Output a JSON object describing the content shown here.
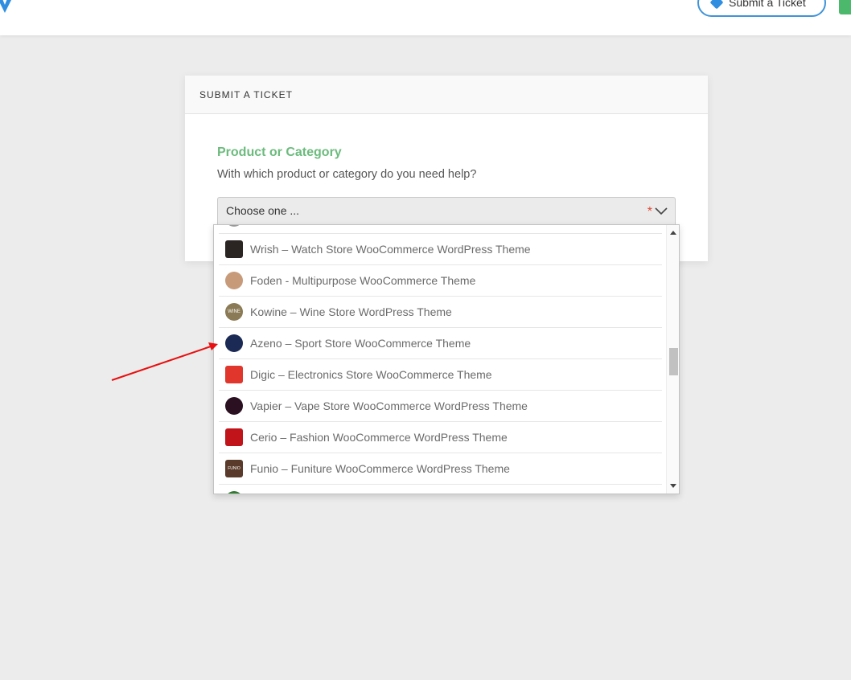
{
  "header": {
    "submit_ticket_label": "Submit a Ticket"
  },
  "card": {
    "title": "SUBMIT A TICKET",
    "field_title": "Product or Category",
    "field_desc": "With which product or category do you need help?"
  },
  "select": {
    "value": "Choose one ...",
    "required_mark": "*"
  },
  "options": [
    {
      "label": "",
      "icon": "partial-icon",
      "color": "#9a9a9a"
    },
    {
      "label": "Wrish – Watch Store WooCommerce WordPress Theme",
      "icon": "wrish-icon",
      "color": "#2a2422"
    },
    {
      "label": "Foden - Multipurpose WooCommerce Theme",
      "icon": "foden-icon",
      "color": "#c79a7a"
    },
    {
      "label": "Kowine – Wine Store WordPress Theme",
      "icon": "kowine-icon",
      "color": "#8a7a55"
    },
    {
      "label": "Azeno – Sport Store WooCommerce Theme",
      "icon": "azeno-icon",
      "color": "#1b2a55"
    },
    {
      "label": "Digic – Electronics Store WooCommerce Theme",
      "icon": "digic-icon",
      "color": "#e0362c"
    },
    {
      "label": "Vapier – Vape Store WooCommerce WordPress Theme",
      "icon": "vapier-icon",
      "color": "#2a1020"
    },
    {
      "label": "Cerio – Fashion WooCommerce WordPress Theme",
      "icon": "cerio-icon",
      "color": "#c0141a"
    },
    {
      "label": "Funio – Funiture WooCommerce WordPress Theme",
      "icon": "funio-icon",
      "color": "#5a3a2a"
    },
    {
      "label": "",
      "icon": "partial-icon",
      "color": "#2f7a2f"
    }
  ],
  "funio_icon_text": "FUNIO",
  "kowine_icon_text": "WINE"
}
